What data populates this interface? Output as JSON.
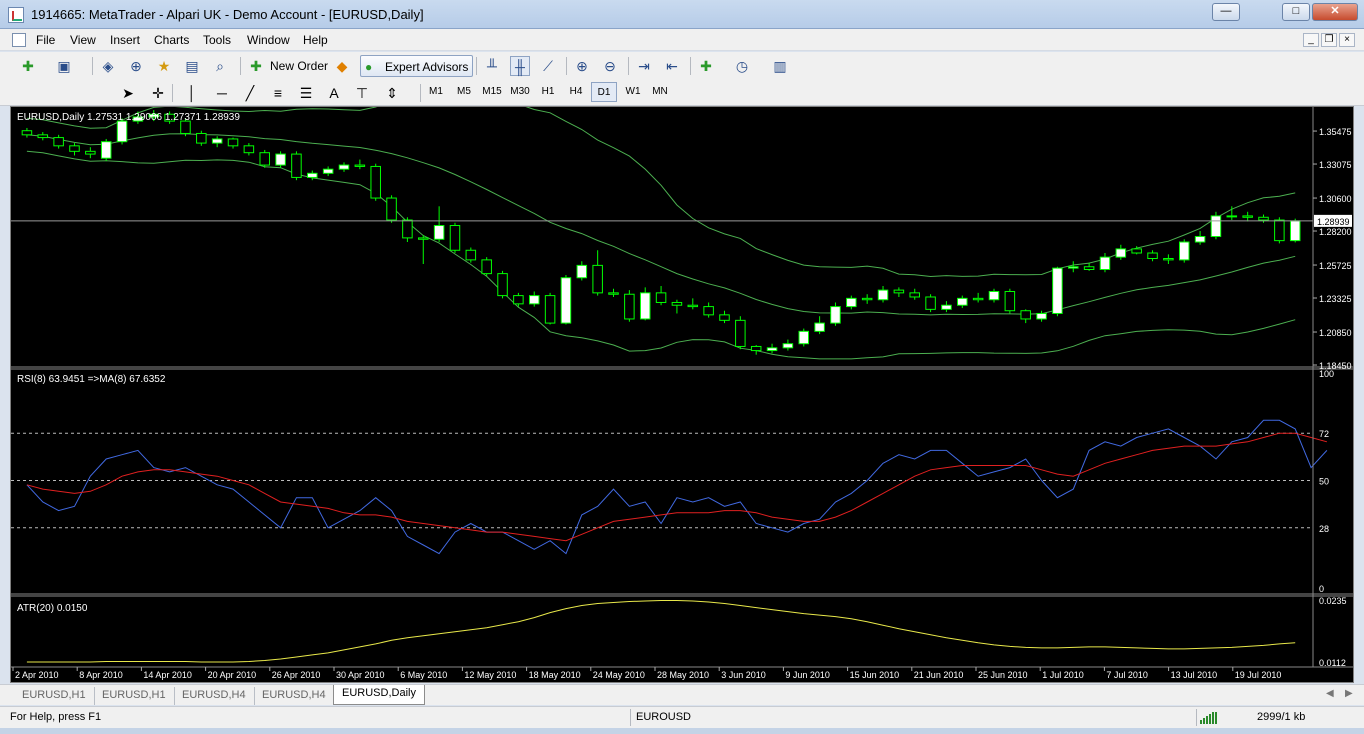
{
  "window": {
    "title": "1914665: MetaTrader - Alpari UK - Demo Account - [EURUSD,Daily]",
    "minimize": "—",
    "maximize": "□",
    "close": "✕"
  },
  "menu": {
    "items": [
      "File",
      "Edit",
      "View",
      "Insert",
      "Charts",
      "Tools",
      "Window",
      "Help"
    ],
    "mdi_minimize": "_",
    "mdi_restore": "❐",
    "mdi_close": "×"
  },
  "toolbar": {
    "new_order": "New Order",
    "expert_advisors": "Expert Advisors",
    "icons": [
      "new-chart-icon",
      "profiles-icon",
      "market-watch-icon",
      "crosshair-icon",
      "favorites-icon",
      "data-window-icon",
      "strategy-tester-icon",
      "alert-icon",
      "bar-chart-icon",
      "candlestick-icon",
      "line-chart-icon",
      "zoom-in-icon",
      "zoom-out-icon",
      "autoscroll-icon",
      "chart-shift-icon",
      "indicators-icon",
      "periods-icon",
      "templates-icon"
    ]
  },
  "drawing_toolbar": {
    "text_tool": "A",
    "timeframes": [
      "M1",
      "M5",
      "M15",
      "M30",
      "H1",
      "H4",
      "D1",
      "W1",
      "MN"
    ],
    "active_timeframe": "D1"
  },
  "chart": {
    "main_label": "EURUSD,Daily  1.27531 1.29006 1.27371 1.28939",
    "current_price": "1.28939",
    "price_ticks": [
      "1.35475",
      "1.33075",
      "1.30600",
      "1.28200",
      "1.25725",
      "1.23325",
      "1.20850",
      "1.18450"
    ],
    "rsi_label": "RSI(8) 63.9451   =>MA(8) 67.6352",
    "rsi_ticks": [
      "100",
      "72",
      "50",
      "28",
      "0"
    ],
    "atr_label": "ATR(20) 0.0150",
    "atr_ticks": [
      "0.0235",
      "0.0112"
    ],
    "date_ticks": [
      "2 Apr 2010",
      "8 Apr 2010",
      "14 Apr 2010",
      "20 Apr 2010",
      "26 Apr 2010",
      "30 Apr 2010",
      "6 May 2010",
      "12 May 2010",
      "18 May 2010",
      "24 May 2010",
      "28 May 2010",
      "3 Jun 2010",
      "9 Jun 2010",
      "15 Jun 2010",
      "21 Jun 2010",
      "25 Jun 2010",
      "1 Jul 2010",
      "7 Jul 2010",
      "13 Jul 2010",
      "19 Jul 2010"
    ]
  },
  "tabs": {
    "items": [
      "EURUSD,H1",
      "EURUSD,H1",
      "EURUSD,H4",
      "EURUSD,H4",
      "EURUSD,Daily"
    ],
    "active": "EURUSD,Daily"
  },
  "status": {
    "help": "For Help, press F1",
    "profile": "EUROUSD",
    "traffic": "2999/1 kb"
  },
  "colors": {
    "bull_candle": "#ffffff",
    "bear_candle": "#000000",
    "candle_wick": "#00ff00",
    "bollinger": "#4caf50",
    "rsi_line": "#4169e1",
    "rsi_ma": "#e02020",
    "atr_line": "#e8e84a",
    "grid_text": "#ffffff"
  },
  "chart_data": [
    {
      "type": "candlestick",
      "title": "EURUSD,Daily",
      "ylim": [
        1.1845,
        1.3708
      ],
      "x": [
        "2010-04-01",
        "2010-04-02",
        "2010-04-05",
        "2010-04-06",
        "2010-04-07",
        "2010-04-08",
        "2010-04-09",
        "2010-04-12",
        "2010-04-13",
        "2010-04-14",
        "2010-04-15",
        "2010-04-16",
        "2010-04-19",
        "2010-04-20",
        "2010-04-21",
        "2010-04-22",
        "2010-04-23",
        "2010-04-26",
        "2010-04-27",
        "2010-04-28",
        "2010-04-29",
        "2010-04-30",
        "2010-05-03",
        "2010-05-04",
        "2010-05-05",
        "2010-05-06",
        "2010-05-07",
        "2010-05-10",
        "2010-05-11",
        "2010-05-12",
        "2010-05-13",
        "2010-05-14",
        "2010-05-17",
        "2010-05-18",
        "2010-05-19",
        "2010-05-20",
        "2010-05-21",
        "2010-05-24",
        "2010-05-25",
        "2010-05-26",
        "2010-05-27",
        "2010-05-28",
        "2010-05-31",
        "2010-06-01",
        "2010-06-02",
        "2010-06-03",
        "2010-06-04",
        "2010-06-07",
        "2010-06-08",
        "2010-06-09",
        "2010-06-10",
        "2010-06-11",
        "2010-06-14",
        "2010-06-15",
        "2010-06-16",
        "2010-06-17",
        "2010-06-18",
        "2010-06-21",
        "2010-06-22",
        "2010-06-23",
        "2010-06-24",
        "2010-06-25",
        "2010-06-28",
        "2010-06-29",
        "2010-06-30",
        "2010-07-01",
        "2010-07-02",
        "2010-07-05",
        "2010-07-06",
        "2010-07-07",
        "2010-07-08",
        "2010-07-09",
        "2010-07-12",
        "2010-07-13",
        "2010-07-14",
        "2010-07-15",
        "2010-07-16",
        "2010-07-19",
        "2010-07-20",
        "2010-07-21",
        "2010-07-22"
      ],
      "open": [
        1.355,
        1.352,
        1.35,
        1.344,
        1.34,
        1.335,
        1.347,
        1.362,
        1.365,
        1.367,
        1.362,
        1.353,
        1.346,
        1.349,
        1.344,
        1.339,
        1.33,
        1.338,
        1.321,
        1.324,
        1.327,
        1.33,
        1.329,
        1.306,
        1.29,
        1.277,
        1.276,
        1.286,
        1.268,
        1.261,
        1.251,
        1.235,
        1.229,
        1.235,
        1.215,
        1.248,
        1.257,
        1.237,
        1.236,
        1.218,
        1.237,
        1.23,
        1.228,
        1.227,
        1.221,
        1.217,
        1.198,
        1.195,
        1.197,
        1.2,
        1.209,
        1.215,
        1.227,
        1.233,
        1.232,
        1.239,
        1.237,
        1.234,
        1.225,
        1.228,
        1.233,
        1.232,
        1.238,
        1.224,
        1.218,
        1.222,
        1.255,
        1.256,
        1.254,
        1.263,
        1.269,
        1.266,
        1.262,
        1.261,
        1.274,
        1.278,
        1.293,
        1.293,
        1.292,
        1.29,
        1.275
      ],
      "close": [
        1.352,
        1.35,
        1.344,
        1.34,
        1.338,
        1.347,
        1.362,
        1.365,
        1.367,
        1.362,
        1.353,
        1.346,
        1.349,
        1.344,
        1.339,
        1.33,
        1.338,
        1.321,
        1.324,
        1.327,
        1.33,
        1.329,
        1.306,
        1.29,
        1.277,
        1.276,
        1.286,
        1.268,
        1.261,
        1.251,
        1.235,
        1.229,
        1.235,
        1.215,
        1.248,
        1.257,
        1.237,
        1.236,
        1.218,
        1.237,
        1.23,
        1.228,
        1.227,
        1.221,
        1.217,
        1.198,
        1.195,
        1.197,
        1.2,
        1.209,
        1.215,
        1.227,
        1.233,
        1.232,
        1.239,
        1.237,
        1.234,
        1.225,
        1.228,
        1.233,
        1.232,
        1.238,
        1.224,
        1.218,
        1.222,
        1.255,
        1.256,
        1.254,
        1.263,
        1.269,
        1.266,
        1.262,
        1.261,
        1.274,
        1.278,
        1.293,
        1.293,
        1.292,
        1.29,
        1.275,
        1.2894
      ],
      "high": [
        1.357,
        1.354,
        1.352,
        1.346,
        1.343,
        1.349,
        1.364,
        1.369,
        1.37,
        1.369,
        1.364,
        1.355,
        1.351,
        1.35,
        1.346,
        1.341,
        1.34,
        1.34,
        1.326,
        1.329,
        1.332,
        1.334,
        1.331,
        1.308,
        1.292,
        1.279,
        1.3,
        1.288,
        1.27,
        1.263,
        1.253,
        1.237,
        1.238,
        1.237,
        1.25,
        1.26,
        1.268,
        1.24,
        1.239,
        1.241,
        1.242,
        1.232,
        1.233,
        1.23,
        1.224,
        1.22,
        1.199,
        1.2,
        1.203,
        1.211,
        1.22,
        1.23,
        1.235,
        1.236,
        1.242,
        1.241,
        1.24,
        1.236,
        1.231,
        1.235,
        1.237,
        1.24,
        1.24,
        1.225,
        1.224,
        1.256,
        1.26,
        1.259,
        1.266,
        1.272,
        1.271,
        1.268,
        1.265,
        1.276,
        1.282,
        1.296,
        1.3,
        1.296,
        1.294,
        1.292,
        1.291
      ],
      "low": [
        1.35,
        1.348,
        1.342,
        1.337,
        1.335,
        1.333,
        1.345,
        1.36,
        1.362,
        1.36,
        1.351,
        1.344,
        1.343,
        1.342,
        1.337,
        1.328,
        1.328,
        1.319,
        1.319,
        1.322,
        1.325,
        1.327,
        1.304,
        1.288,
        1.274,
        1.258,
        1.274,
        1.266,
        1.259,
        1.249,
        1.233,
        1.227,
        1.227,
        1.214,
        1.214,
        1.246,
        1.235,
        1.234,
        1.216,
        1.217,
        1.228,
        1.222,
        1.225,
        1.219,
        1.215,
        1.196,
        1.192,
        1.193,
        1.195,
        1.198,
        1.207,
        1.213,
        1.225,
        1.229,
        1.23,
        1.234,
        1.232,
        1.223,
        1.223,
        1.226,
        1.23,
        1.23,
        1.222,
        1.215,
        1.216,
        1.22,
        1.252,
        1.253,
        1.252,
        1.261,
        1.265,
        1.26,
        1.258,
        1.259,
        1.272,
        1.276,
        1.29,
        1.289,
        1.288,
        1.273,
        1.2737
      ]
    },
    {
      "type": "line",
      "title": "RSI(8) 63.9451   =>MA(8) 67.6352",
      "ylim": [
        0,
        100
      ],
      "levels": [
        28,
        50,
        72
      ],
      "series": [
        {
          "name": "RSI(8)",
          "values": [
            48,
            40,
            36,
            38,
            52,
            60,
            62,
            64,
            56,
            54,
            56,
            52,
            48,
            46,
            40,
            34,
            28,
            42,
            42,
            28,
            32,
            36,
            42,
            36,
            24,
            20,
            16,
            26,
            30,
            26,
            26,
            22,
            18,
            22,
            16,
            34,
            38,
            46,
            38,
            40,
            30,
            42,
            40,
            42,
            38,
            40,
            30,
            28,
            26,
            30,
            32,
            40,
            44,
            50,
            58,
            62,
            60,
            64,
            64,
            58,
            52,
            54,
            56,
            60,
            50,
            42,
            46,
            64,
            68,
            66,
            70,
            72,
            74,
            70,
            66,
            60,
            68,
            70,
            78,
            78,
            74,
            56,
            64
          ]
        },
        {
          "name": "MA(8)",
          "values": [
            48,
            46,
            45,
            44,
            45,
            48,
            52,
            54,
            55,
            55,
            54,
            53,
            52,
            50,
            48,
            44,
            40,
            39,
            38,
            37,
            35,
            34,
            34,
            33,
            31,
            30,
            29,
            28,
            27,
            26,
            26,
            25,
            24,
            23,
            22,
            25,
            28,
            31,
            32,
            33,
            34,
            35,
            35,
            35,
            36,
            36,
            35,
            33,
            32,
            31,
            31,
            33,
            36,
            40,
            44,
            48,
            52,
            55,
            56,
            57,
            57,
            57,
            57,
            57,
            55,
            53,
            52,
            55,
            58,
            60,
            62,
            64,
            65,
            66,
            66,
            66,
            67,
            68,
            70,
            72,
            72,
            70,
            68
          ]
        }
      ]
    },
    {
      "type": "line",
      "title": "ATR(20) 0.0150",
      "ylim": [
        0.0112,
        0.0235
      ],
      "series": [
        {
          "name": "ATR(20)",
          "values": [
            0.0112,
            0.0112,
            0.0112,
            0.0112,
            0.0112,
            0.0113,
            0.0113,
            0.0113,
            0.0113,
            0.0113,
            0.0113,
            0.0112,
            0.0112,
            0.0112,
            0.0113,
            0.0115,
            0.0118,
            0.0122,
            0.0126,
            0.013,
            0.0136,
            0.0142,
            0.0148,
            0.0155,
            0.016,
            0.0164,
            0.0168,
            0.0172,
            0.0176,
            0.018,
            0.0186,
            0.0192,
            0.02,
            0.021,
            0.0218,
            0.0224,
            0.0228,
            0.023,
            0.0232,
            0.0233,
            0.0234,
            0.0234,
            0.0233,
            0.0231,
            0.0228,
            0.0224,
            0.022,
            0.0216,
            0.0212,
            0.0208,
            0.0205,
            0.0202,
            0.0198,
            0.0192,
            0.0185,
            0.0178,
            0.0172,
            0.0166,
            0.016,
            0.0155,
            0.015,
            0.0146,
            0.0143,
            0.0141,
            0.014,
            0.014,
            0.0141,
            0.0142,
            0.0142,
            0.0141,
            0.014,
            0.0139,
            0.0138,
            0.0138,
            0.0139,
            0.014,
            0.0141,
            0.0143,
            0.0145,
            0.0148,
            0.015
          ]
        }
      ]
    }
  ]
}
